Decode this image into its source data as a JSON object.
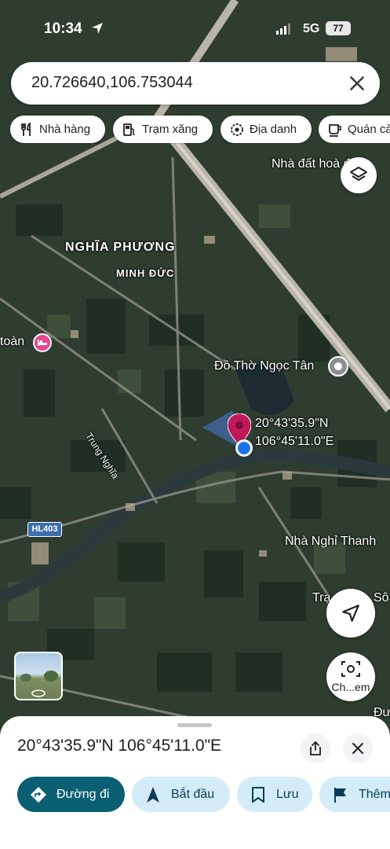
{
  "status_bar": {
    "time": "10:34",
    "network": "5G",
    "battery": "77"
  },
  "search": {
    "query": "20.726640,106.753044"
  },
  "chips": [
    {
      "label": "Nhà hàng",
      "icon": "restaurant-icon"
    },
    {
      "label": "Trạm xăng",
      "icon": "gas-station-icon"
    },
    {
      "label": "Địa danh",
      "icon": "landmark-icon"
    },
    {
      "label": "Quán cà",
      "icon": "coffee-icon"
    }
  ],
  "map_labels": {
    "area_1": "NGHĨA PHƯƠNG",
    "area_2": "MINH ĐỨC",
    "place_1": "Nhà đất hoà điệp",
    "place_2": "Đồ Thờ Ngọc Tân",
    "place_3": "Nhà Nghỉ Thanh",
    "place_4": "toàn",
    "place_5": "Trạ",
    "place_6": "Sô",
    "place_7": "Đư",
    "road_1": "Trung Nghĩa",
    "road_shield": "HL403",
    "pin_lat": "20°43'35.9\"N",
    "pin_lng": "106°45'11.0\"E",
    "street_view_button_label": "Ch...em"
  },
  "bottom_sheet": {
    "coordinates": "20°43'35.9\"N 106°45'11.0\"E",
    "actions": [
      {
        "label": "Đường đi",
        "icon": "directions-icon"
      },
      {
        "label": "Bắt đầu",
        "icon": "navigation-icon"
      },
      {
        "label": "Lưu",
        "icon": "bookmark-icon"
      },
      {
        "label": "Thêm",
        "icon": "flag-icon"
      }
    ]
  },
  "colors": {
    "accent": "#0b5f73",
    "action_bg": "#d3ecf8",
    "pin": "#c2185b",
    "location_dot": "#1a73e8"
  }
}
